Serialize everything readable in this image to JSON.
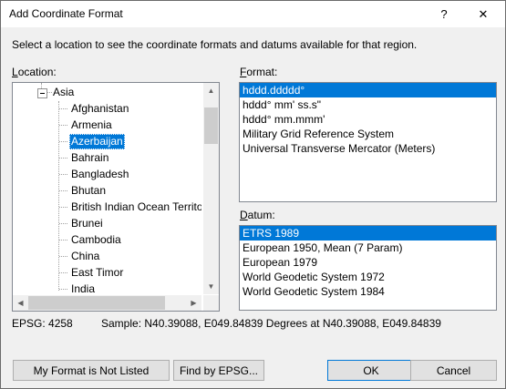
{
  "window": {
    "title": "Add Coordinate Format",
    "help_label": "?",
    "close_label": "✕"
  },
  "description": "Select a location to see the coordinate formats and datums available for that region.",
  "location": {
    "label": "Location:",
    "parent": "Asia",
    "items": [
      "Afghanistan",
      "Armenia",
      "Azerbaijan",
      "Bahrain",
      "Bangladesh",
      "Bhutan",
      "British Indian Ocean Territor",
      "Brunei",
      "Cambodia",
      "China",
      "East Timor",
      "India"
    ],
    "selected": "Azerbaijan"
  },
  "format": {
    "label": "Format:",
    "items": [
      "hddd.ddddd°",
      "hddd° mm' ss.s\"",
      "hddd° mm.mmm'",
      "Military Grid Reference System",
      "Universal Transverse Mercator (Meters)"
    ],
    "selected": "hddd.ddddd°"
  },
  "datum": {
    "label": "Datum:",
    "items": [
      "ETRS 1989",
      "European 1950, Mean (7 Param)",
      "European 1979",
      "World Geodetic System 1972",
      "World Geodetic System 1984"
    ],
    "selected": "ETRS 1989"
  },
  "status": {
    "epsg": "EPSG: 4258",
    "sample": "Sample: N40.39088, E049.84839 Degrees at N40.39088, E049.84839"
  },
  "buttons": {
    "not_listed": "My Format is Not Listed",
    "find_epsg": "Find by EPSG...",
    "ok": "OK",
    "cancel": "Cancel"
  },
  "icons": {
    "scroll_up": "▲",
    "scroll_down": "▼",
    "scroll_left": "◀",
    "scroll_right": "▶"
  },
  "colors": {
    "selection": "#0078d7",
    "face": "#f0f0f0",
    "default_button_border": "#0078d7"
  }
}
